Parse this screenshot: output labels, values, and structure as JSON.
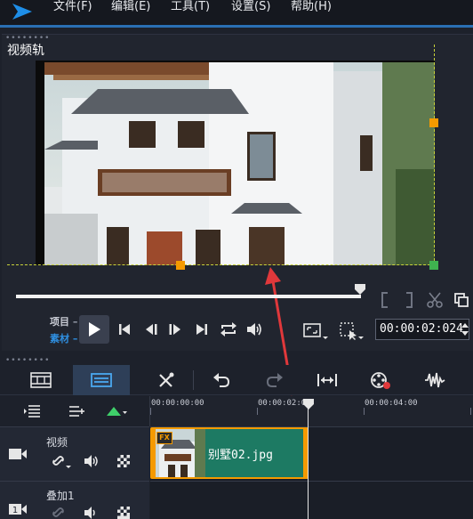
{
  "menu": {
    "file": "文件(F)",
    "edit": "编辑(E)",
    "tools": "工具(T)",
    "settings": "设置(S)",
    "help": "帮助(H)"
  },
  "preview": {
    "track_label": "视频轨",
    "mode_project": "项目",
    "mode_clip": "素材",
    "timecode": "00:00:02:024",
    "scrub_position_percent": 100
  },
  "ruler": {
    "labels": [
      "00:00:00:00",
      "00:00:02:00",
      "00:00:04:00"
    ]
  },
  "tracks": [
    {
      "name": "视频"
    },
    {
      "name": "叠加1"
    }
  ],
  "clip": {
    "label": "别墅02.jpg",
    "fx_badge": "FX"
  },
  "colors": {
    "accent": "#2a6fb3",
    "handle": "#f59a00",
    "clip": "#1d7a63",
    "mode_active": "#2f8fe0",
    "annotation_arrow": "#e0383b"
  }
}
